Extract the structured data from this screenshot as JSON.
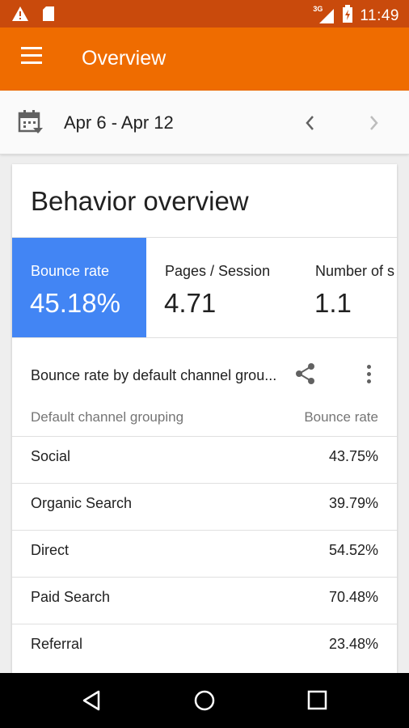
{
  "status_bar": {
    "network": "3G",
    "time": "11:49"
  },
  "app_bar": {
    "title": "Overview"
  },
  "date_bar": {
    "range": "Apr 6 - Apr 12"
  },
  "card": {
    "title": "Behavior overview",
    "metrics": [
      {
        "label": "Bounce rate",
        "value": "45.18%",
        "selected": true
      },
      {
        "label": "Pages / Session",
        "value": "4.71",
        "selected": false
      },
      {
        "label": "Number of s",
        "value": "1.1",
        "selected": false
      }
    ],
    "section_title": "Bounce rate by default channel grou...",
    "columns": {
      "left": "Default channel grouping",
      "right": "Bounce rate"
    },
    "rows": [
      {
        "name": "Social",
        "value": "43.75%"
      },
      {
        "name": "Organic Search",
        "value": "39.79%"
      },
      {
        "name": "Direct",
        "value": "54.52%"
      },
      {
        "name": "Paid Search",
        "value": "70.48%"
      },
      {
        "name": "Referral",
        "value": "23.48%"
      }
    ]
  },
  "colors": {
    "status_bar": "#c94a0c",
    "app_bar": "#ef6c00",
    "selected_metric": "#4285f4"
  }
}
